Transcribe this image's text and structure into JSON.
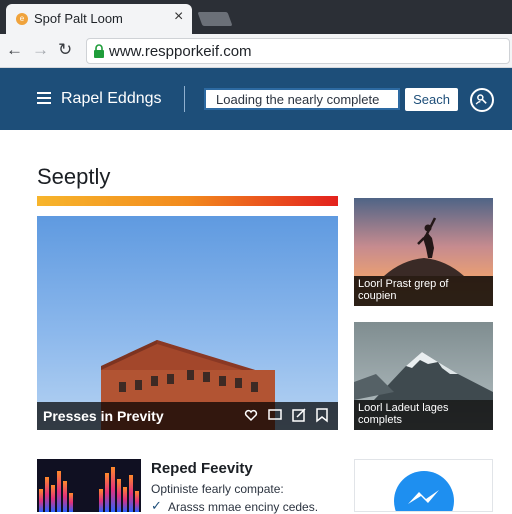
{
  "browser": {
    "tab": {
      "title": "Spof Palt Loom",
      "close": "×",
      "favicon": "e"
    },
    "nav": {
      "back": "←",
      "forward": "→",
      "reload": "↻"
    },
    "url": "www.respporkeif.com"
  },
  "header": {
    "brand": "Rapel Eddngs",
    "search_value": "Loading the nearly complete",
    "search_button": "Seach"
  },
  "main": {
    "section_title": "Seeptly",
    "hero": {
      "caption": "Presses in Previty"
    },
    "cards": [
      {
        "caption": "Loorl Prast grep of coupien"
      },
      {
        "caption": "Loorl Ladeut lages complets"
      }
    ],
    "article": {
      "title": "Reped Feevity",
      "subtitle": "Optiniste fearly compate:",
      "check_item": "Arasss mmae enciny cedes."
    }
  },
  "colors": {
    "header_bg": "#1d4e79",
    "accent_start": "#f7b52c",
    "accent_end": "#e3211d",
    "messenger_blue": "#1e8ff0"
  },
  "icons": {
    "hero_actions": [
      "heart-icon",
      "comment-icon",
      "edit-icon",
      "bookmark-icon"
    ],
    "profile": "search-person-icon",
    "lock": "lock-icon"
  }
}
